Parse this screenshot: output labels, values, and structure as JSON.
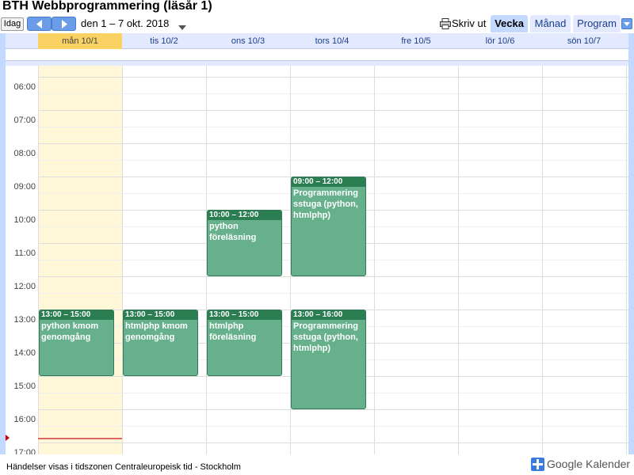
{
  "title": "BTH Webbprogrammering (läsår 1)",
  "nav": {
    "today_label": "Idag",
    "range": "den 1 – 7 okt. 2018",
    "print_label": "Skriv ut",
    "tabs": {
      "week": "Vecka",
      "month": "Månad",
      "agenda": "Program"
    },
    "active_tab": "Vecka"
  },
  "days": [
    {
      "label": "mån 10/1",
      "today": true
    },
    {
      "label": "tis 10/2"
    },
    {
      "label": "ons 10/3"
    },
    {
      "label": "tors 10/4"
    },
    {
      "label": "fre 10/5"
    },
    {
      "label": "lör 10/6"
    },
    {
      "label": "sön 10/7"
    }
  ],
  "hours": [
    "06:00",
    "07:00",
    "08:00",
    "09:00",
    "10:00",
    "11:00",
    "12:00",
    "13:00",
    "14:00",
    "15:00",
    "16:00",
    "17:00"
  ],
  "events": [
    {
      "day": 0,
      "start": 13,
      "end": 15,
      "time": "13:00 – 15:00",
      "title": "python kmom genomgång"
    },
    {
      "day": 1,
      "start": 13,
      "end": 15,
      "time": "13:00 – 15:00",
      "title": "htmlphp kmom genomgång"
    },
    {
      "day": 2,
      "start": 10,
      "end": 12,
      "time": "10:00 – 12:00",
      "title": "python föreläsning"
    },
    {
      "day": 2,
      "start": 13,
      "end": 15,
      "time": "13:00 – 15:00",
      "title": "htmlphp föreläsning"
    },
    {
      "day": 3,
      "start": 9,
      "end": 12,
      "time": "09:00 – 12:00",
      "title": "Programmering sstuga (python, htmlphp)"
    },
    {
      "day": 3,
      "start": 13,
      "end": 16,
      "time": "13:00 – 16:00",
      "title": "Programmering sstuga (python, htmlphp)"
    }
  ],
  "footer": {
    "timezone": "Händelser visas i tidszonen Centraleuropeisk tid - Stockholm",
    "brand": "Google Kalender"
  },
  "colors": {
    "event_bg": "#66b08c",
    "event_header": "#2a7e52",
    "today_bg": "#fff7d7",
    "accent": "#c3d9ff"
  }
}
